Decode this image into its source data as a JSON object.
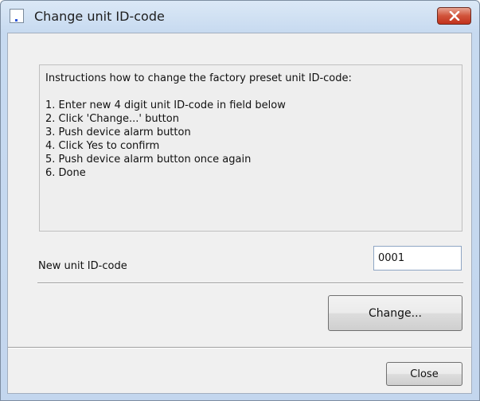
{
  "window": {
    "title": "Change unit ID-code"
  },
  "instructions": {
    "heading": "Instructions how to change the factory preset unit ID-code:",
    "steps": [
      "1. Enter new 4 digit unit ID-code in field below",
      "2. Click 'Change...' button",
      "3. Push device alarm button",
      "4. Click Yes to confirm",
      "5. Push device alarm button once again",
      "6. Done"
    ]
  },
  "id_field": {
    "label": "New unit ID-code",
    "value": "0001"
  },
  "buttons": {
    "change_label": "Change...",
    "close_label": "Close"
  },
  "icons": {
    "app": "app-window-icon",
    "close": "close-icon"
  },
  "colors": {
    "close_button": "#c7432b",
    "titlebar": "#c7daf0",
    "client": "#f0f0f0"
  }
}
